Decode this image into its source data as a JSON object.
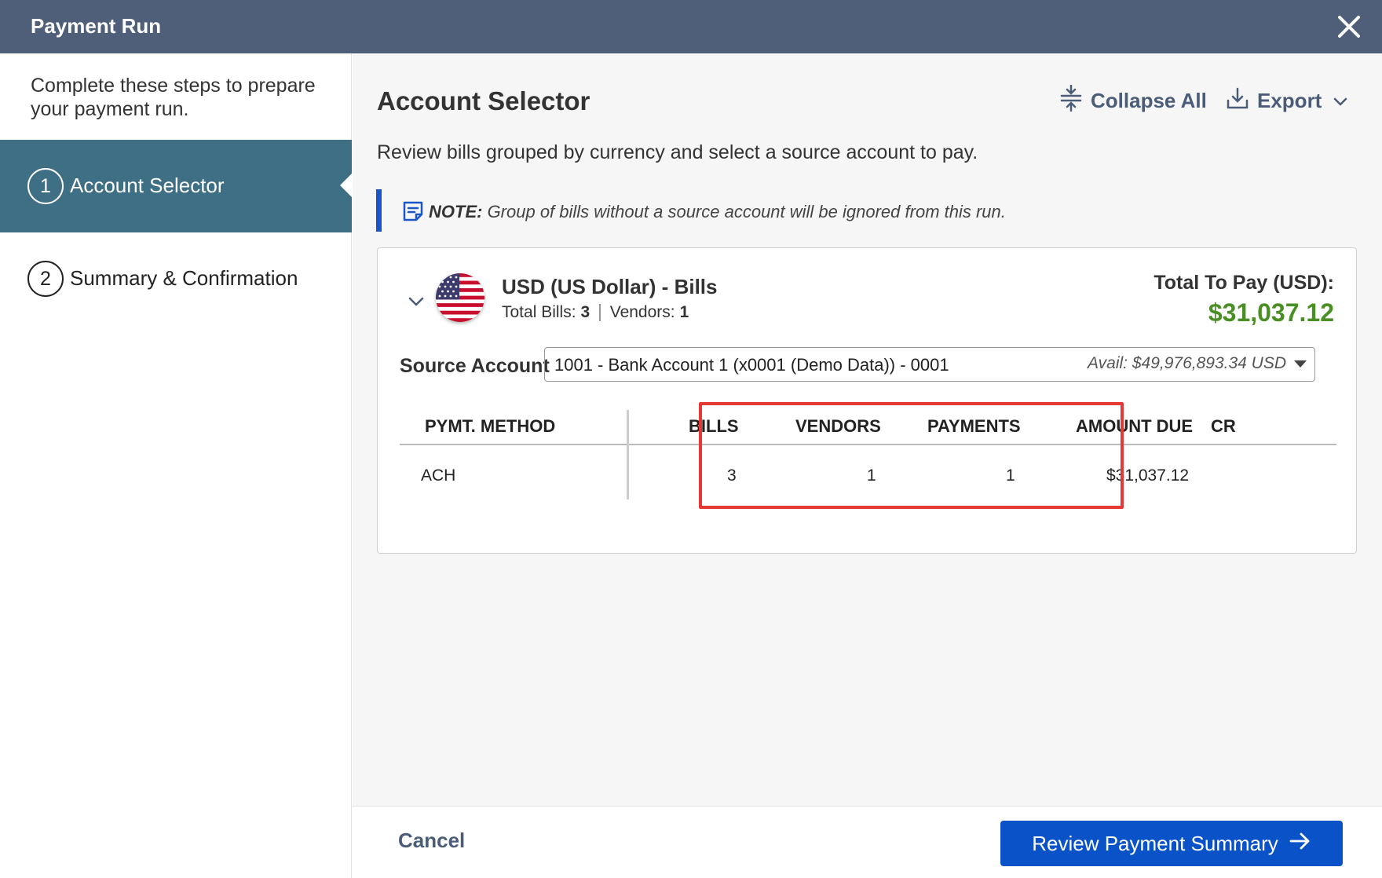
{
  "dialog": {
    "title": "Payment Run"
  },
  "sidebar": {
    "intro": "Complete these steps to prepare your payment run.",
    "steps": [
      {
        "number": "1",
        "label": "Account Selector",
        "active": true
      },
      {
        "number": "2",
        "label": "Summary & Confirmation",
        "active": false
      }
    ]
  },
  "main": {
    "heading": "Account Selector",
    "collapse_label": "Collapse All",
    "export_label": "Export",
    "description": "Review bills grouped by currency and select a source account to pay.",
    "note": {
      "prefix": "NOTE:",
      "text": " Group of bills without a source account will be ignored from this run."
    }
  },
  "currency_group": {
    "title": "USD (US Dollar) - Bills",
    "total_bills_label": "Total Bills:",
    "total_bills": "3",
    "vendors_label": "Vendors:",
    "vendors": "1",
    "total_to_pay_label": "Total To Pay (USD):",
    "total_to_pay": "$31,037.12",
    "source_account_label": "Source Account",
    "source_account_value": "1001 - Bank Account 1 (x0001 (Demo Data)) - 0001",
    "source_account_avail": "Avail: $49,976,893.34 USD",
    "table": {
      "headers": {
        "method": "PYMT. METHOD",
        "bills": "BILLS",
        "vendors": "VENDORS",
        "payments": "PAYMENTS",
        "amount_due": "AMOUNT DUE",
        "cr": "CR"
      },
      "rows": [
        {
          "method": "ACH",
          "bills": "3",
          "vendors": "1",
          "payments": "1",
          "amount_due": "$31,037.12"
        }
      ]
    }
  },
  "footer": {
    "cancel_label": "Cancel",
    "primary_label": "Review Payment Summary"
  },
  "colors": {
    "titlebar": "#4f5f7a",
    "active_step": "#3f6f85",
    "accent_blue": "#0a52c8",
    "total_green": "#4a8f24",
    "highlight_red": "#e53935"
  }
}
